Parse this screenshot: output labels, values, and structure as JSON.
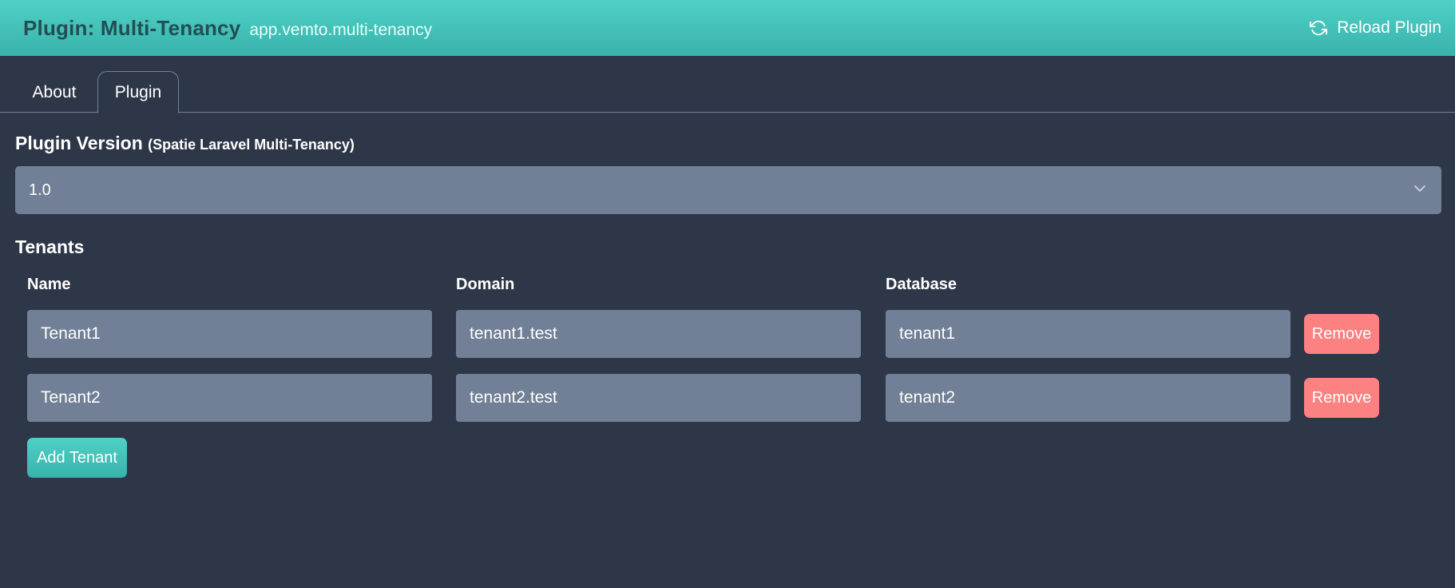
{
  "header": {
    "title": "Plugin: Multi-Tenancy",
    "subtitle": "app.vemto.multi-tenancy",
    "reload_label": "Reload Plugin",
    "reload_icon": "refresh-icon"
  },
  "tabs": [
    {
      "label": "About",
      "active": false
    },
    {
      "label": "Plugin",
      "active": true
    }
  ],
  "version": {
    "label": "Plugin Version",
    "sublabel": "(Spatie Laravel Multi-Tenancy)",
    "selected": "1.0",
    "icon": "chevron-down-icon"
  },
  "tenants": {
    "title": "Tenants",
    "columns": [
      "Name",
      "Domain",
      "Database"
    ],
    "rows": [
      {
        "name": "Tenant1",
        "domain": "tenant1.test",
        "database": "tenant1",
        "remove_label": "Remove"
      },
      {
        "name": "Tenant2",
        "domain": "tenant2.test",
        "database": "tenant2",
        "remove_label": "Remove"
      }
    ],
    "add_label": "Add Tenant"
  },
  "colors": {
    "background": "#2e3748",
    "accent": "#4fd1c5",
    "field": "#718096",
    "danger": "#fc8181"
  }
}
